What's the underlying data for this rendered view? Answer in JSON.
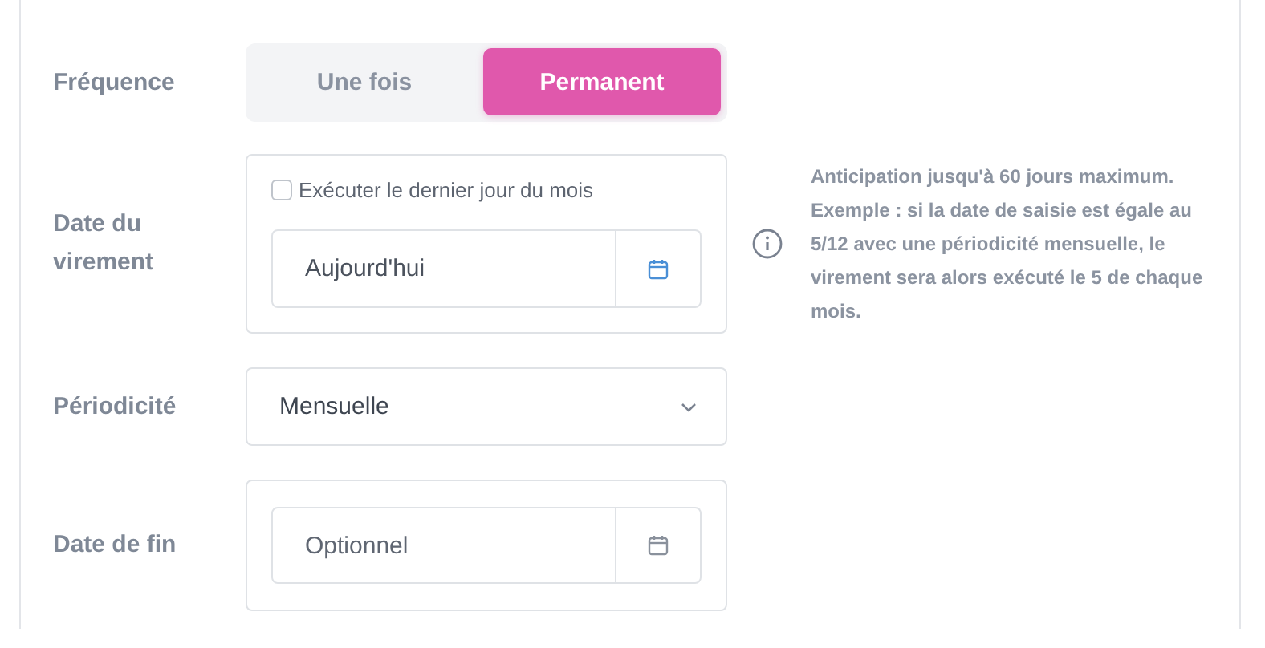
{
  "frequency": {
    "label": "Fréquence",
    "options": [
      {
        "label": "Une fois",
        "selected": false
      },
      {
        "label": "Permanent",
        "selected": true
      }
    ]
  },
  "transfer_date": {
    "label": "Date du virement",
    "checkbox": {
      "label": "Exécuter le dernier jour du mois",
      "checked": false
    },
    "field": {
      "value": "Aujourd'hui"
    },
    "info": "Anticipation jusqu'à 60 jours maximum. Exemple : si la date de saisie est égale au 5/12 avec une périodicité mensuelle, le virement sera alors exécuté le 5 de chaque mois."
  },
  "periodicity": {
    "label": "Périodicité",
    "value": "Mensuelle"
  },
  "end_date": {
    "label": "Date de fin",
    "field": {
      "placeholder": "Optionnel"
    }
  }
}
